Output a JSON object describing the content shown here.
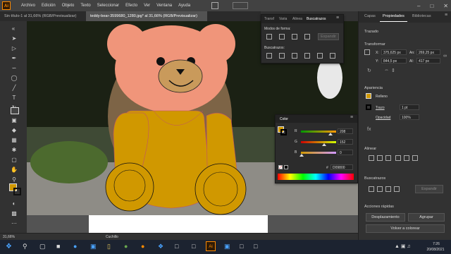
{
  "app": {
    "logo": "Ai"
  },
  "menu": [
    "Archivo",
    "Edición",
    "Objeto",
    "Texto",
    "Seleccionar",
    "Efecto",
    "Ver",
    "Ventana",
    "Ayuda"
  ],
  "document_tabs": [
    {
      "label": "Sin título-1 al 31,66% (RGB/Previsualizar)"
    },
    {
      "label": "teddy-bear-3599680_1280.jpg* al 31,66% (RGB/Previsualizar)"
    }
  ],
  "float_panel": {
    "tabs": [
      "Transf",
      "Varia",
      "Alinea",
      "Buscatrazos"
    ],
    "modos_label": "Modos de forma:",
    "expandir_label": "Expandir",
    "buscatrazos_label": "Buscatrazos:"
  },
  "color_panel": {
    "title": "Color",
    "r": {
      "label": "R",
      "value": "208"
    },
    "g": {
      "label": "G",
      "value": "152"
    },
    "b": {
      "label": "B",
      "value": "0"
    },
    "hex_prefix": "#",
    "hex": "D09800"
  },
  "status": {
    "zoom": "31,66%",
    "tool": "Cuchillo"
  },
  "right_panel": {
    "tabs": [
      "Capas",
      "Propiedades",
      "Bibliotecas"
    ],
    "trazado": "Trazado",
    "transformar": "Transformar",
    "x_label": "X:",
    "x_value": "375,625 px",
    "y_label": "Y:",
    "y_value": "844,5 px",
    "w_label": "An:",
    "w_value": "269,25 px",
    "h_label": "Al:",
    "h_value": "417 px",
    "apariencia": "Apariencia",
    "relleno": "Relleno",
    "trazo": "Trazo",
    "trazo_value": "1 pt",
    "opacidad": "Opacidad",
    "opacidad_value": "100%",
    "alinear": "Alinear",
    "buscatrazos": "Buscatrazos",
    "expandir": "Expandir",
    "acciones": "Acciones rápidas",
    "desplazamiento": "Desplazamiento",
    "agrupar": "Agrupar",
    "volver": "Volver a colorear"
  },
  "taskbar": {
    "time": "7:26",
    "date": "20/08/2021"
  },
  "colors": {
    "fill": "#D09800",
    "face": "#F0957A",
    "snout": "#C99A5B"
  }
}
